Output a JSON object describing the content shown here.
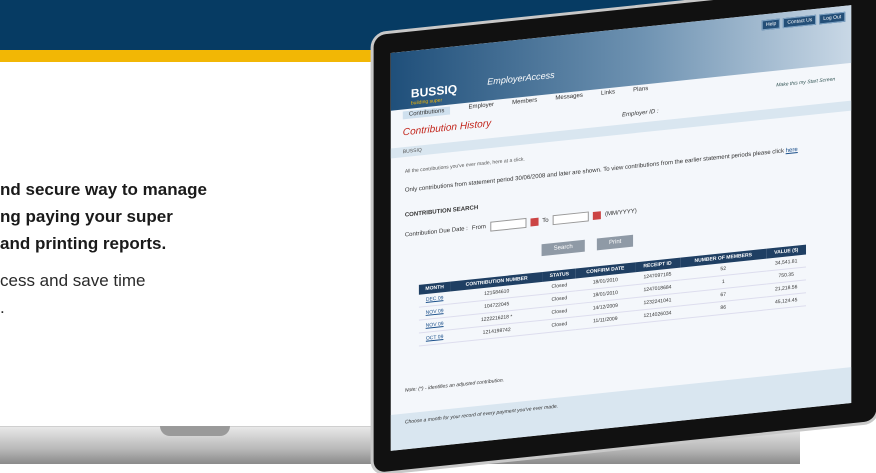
{
  "marketing": {
    "line1": "nd secure way to manage",
    "line2": "ng paying your super",
    "line3": "and printing reports.",
    "line4": "cess and save time",
    "line5": "."
  },
  "app": {
    "logo": "BUSSIQ",
    "tagline": "building super",
    "name": "EmployerAccess",
    "util_links": [
      "Help",
      "Contact Us",
      "Log Out"
    ],
    "nav": [
      "Contributions",
      "Employer",
      "Members",
      "Messages",
      "Links",
      "Plans"
    ],
    "take_tour": "Make this my Start Screen",
    "page_title": "Contribution History",
    "employer_label": "Employer ID :",
    "breadcrumb": "BUSSIQ",
    "intro1": "All the contributions you've ever made, here at a click.",
    "intro2_pre": "Only contributions from statement period 30/06/2008 and later are shown. To view contributions from the earlier statement periods please click",
    "intro2_link": "here",
    "search_heading": "CONTRIBUTION SEARCH",
    "due_date_label": "Contribution Due Date :",
    "from_label": "From",
    "to_label": "To",
    "date_format": "(MM/YYYY)",
    "search_button": "Search",
    "print_button": "Print",
    "table_headers": [
      "MONTH",
      "CONTRIBUTION NUMBER",
      "STATUS",
      "CONFIRM DATE",
      "RECEIPT ID",
      "NUMBER OF MEMBERS",
      "VALUE ($)"
    ],
    "rows": [
      {
        "month": "DEC 09",
        "number": "121584610",
        "status": "Closed",
        "confirm": "18/01/2010",
        "receipt": "1247097185",
        "members": "52",
        "value": "34,541.81"
      },
      {
        "month": "NOV 09",
        "number": "104722045",
        "status": "Closed",
        "confirm": "18/01/2010",
        "receipt": "1247018684",
        "members": "1",
        "value": "750.35"
      },
      {
        "month": "NOV 09",
        "number": "1222216218 *",
        "status": "Closed",
        "confirm": "14/12/2009",
        "receipt": "1232241041",
        "members": "67",
        "value": "21,218.56"
      },
      {
        "month": "OCT 09",
        "number": "1214198742",
        "status": "Closed",
        "confirm": "11/11/2009",
        "receipt": "1214026034",
        "members": "86",
        "value": "45,124.45"
      }
    ],
    "note": "Note: (*) - identifies an adjusted contribution.",
    "footer": "Choose a month for your record of every payment you've ever made."
  }
}
